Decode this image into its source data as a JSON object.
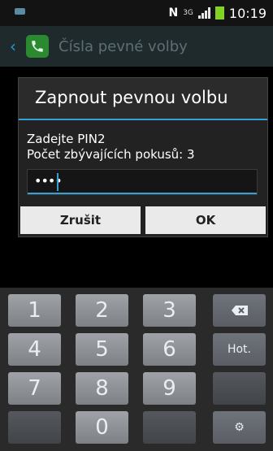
{
  "status_bar": {
    "network_mode": "N",
    "network_type": "3G",
    "time": "10:19"
  },
  "action_bar": {
    "title": "Čísla pevné volby"
  },
  "dialog": {
    "title": "Zapnout pevnou volbu",
    "message_line1": "Zadejte PIN2",
    "message_line2": "Počet zbývajících pokusů: 3",
    "pin_value": "••••",
    "cancel_label": "Zrušit",
    "ok_label": "OK"
  },
  "keypad": {
    "k1": "1",
    "k2": "2",
    "k3": "3",
    "k4": "4",
    "k5": "5",
    "k6": "6",
    "k7": "7",
    "k8": "8",
    "k9": "9",
    "k0": "0",
    "hot": "Hot.",
    "backspace_icon": "backspace-icon",
    "settings_icon": "gear-icon"
  },
  "colors": {
    "accent": "#35a0d3",
    "app_icon": "#2b8a2f",
    "battery": "#7ed321"
  }
}
